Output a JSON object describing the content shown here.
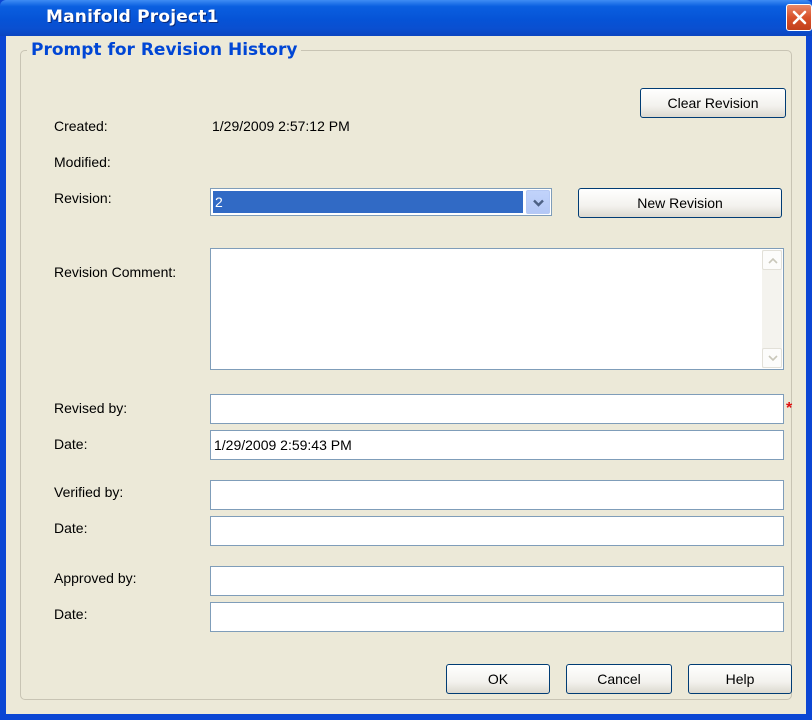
{
  "window": {
    "title": "Manifold Project1"
  },
  "group": {
    "legend": "Prompt for Revision History"
  },
  "created": {
    "label": "Created:",
    "value": "1/29/2009 2:57:12 PM"
  },
  "modified": {
    "label": "Modified:",
    "value": ""
  },
  "revision": {
    "label": "Revision:",
    "value": "2"
  },
  "revision_comment": {
    "label": "Revision Comment:",
    "value": ""
  },
  "revised_by": {
    "label": "Revised by:",
    "value": "",
    "required_marker": "*"
  },
  "revised_date": {
    "label": "Date:",
    "value": "1/29/2009 2:59:43 PM"
  },
  "verified_by": {
    "label": "Verified by:",
    "value": ""
  },
  "verified_date": {
    "label": "Date:",
    "value": ""
  },
  "approved_by": {
    "label": "Approved by:",
    "value": ""
  },
  "approved_date": {
    "label": "Date:",
    "value": ""
  },
  "buttons": {
    "clear_revision": "Clear Revision",
    "new_revision": "New Revision",
    "ok": "OK",
    "cancel": "Cancel",
    "help": "Help"
  },
  "icons": {
    "close": "close-icon",
    "dropdown": "chevron-down-icon",
    "scroll_up": "scroll-up-icon",
    "scroll_down": "scroll-down-icon"
  },
  "colors": {
    "title_bar": "#0653d6",
    "legend_text": "#0046d5",
    "selection": "#316ac5",
    "required": "#e01010"
  }
}
